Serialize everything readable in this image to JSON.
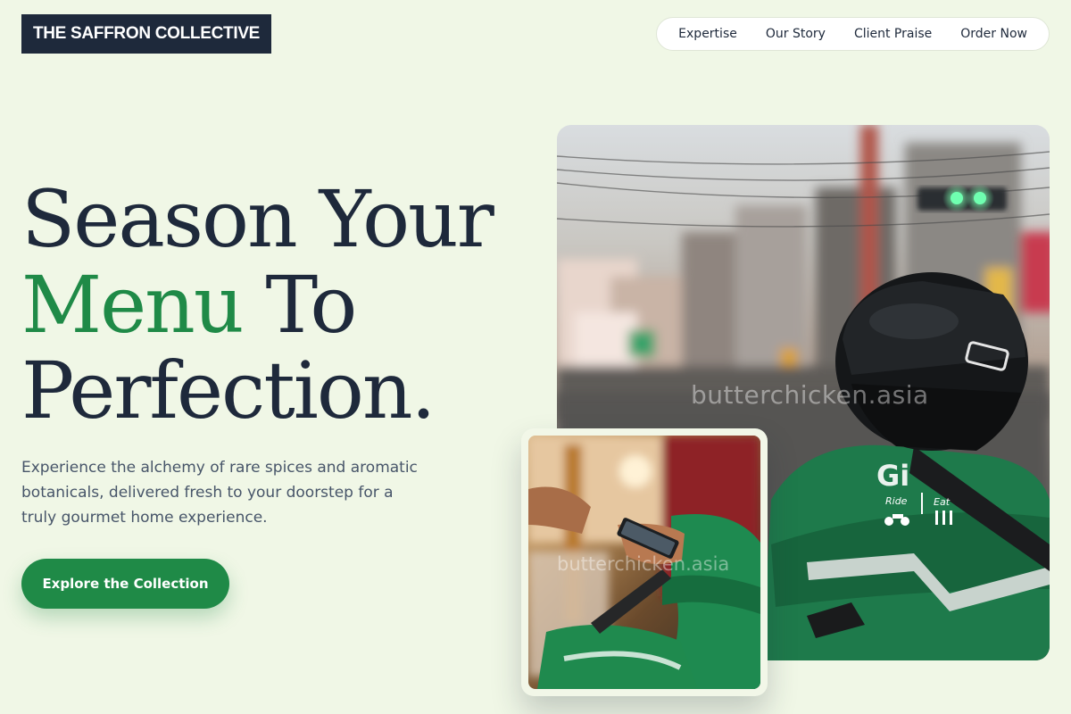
{
  "brand": {
    "logo_text": "THE SAFFRON COLLECTIVE"
  },
  "nav": {
    "items": [
      {
        "label": "Expertise"
      },
      {
        "label": "Our Story"
      },
      {
        "label": "Client Praise"
      },
      {
        "label": "Order Now"
      }
    ]
  },
  "hero": {
    "headline_line1": "Season Your",
    "headline_accent": "Menu",
    "headline_line2_rest": " To",
    "headline_line3": "Perfection.",
    "description": "Experience the alchemy of rare spices and aromatic botanicals, delivered fresh to your doorstep for a truly gourmet home experience.",
    "cta_label": "Explore the Collection"
  },
  "images": {
    "main_watermark": "butterchicken.asia",
    "inset_watermark": "butterchicken.asia",
    "jacket_brand": "Gi",
    "jacket_ride": "Ride",
    "jacket_eat": "Eat"
  },
  "colors": {
    "background": "#f0f7e6",
    "navy": "#1e293b",
    "accent_green": "#1f8a47",
    "body_text": "#475569"
  }
}
